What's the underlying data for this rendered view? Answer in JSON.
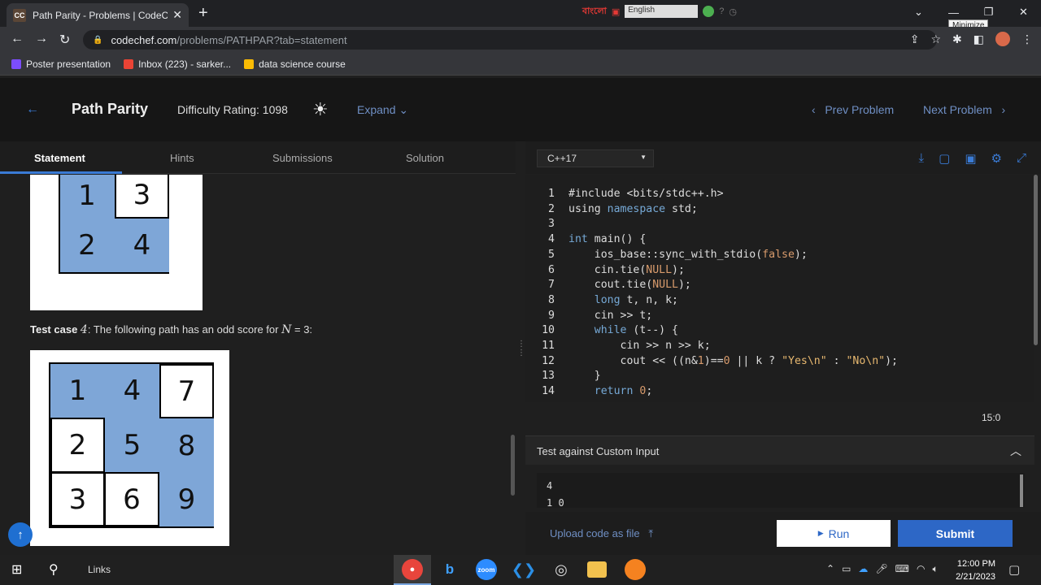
{
  "browser": {
    "tab_title": "Path Parity - Problems | CodeChef",
    "tab_favicon": "CC",
    "url_host": "codechef.com",
    "url_path": "/problems/PATHPAR?tab=statement",
    "tooltip": "Minimize",
    "ext_lang": "বাংলো",
    "ext_select": "English",
    "bookmarks": [
      "Poster presentation",
      "Inbox (223) - sarker...",
      "data science course"
    ]
  },
  "header": {
    "title": "Path Parity",
    "difficulty": "Difficulty Rating: 1098",
    "expand": "Expand",
    "prev": "Prev Problem",
    "next": "Next Problem"
  },
  "left_tabs": [
    "Statement",
    "Hints",
    "Submissions",
    "Solution"
  ],
  "statement": {
    "grid3_top": [
      "1",
      "3",
      "2",
      "4"
    ],
    "tc4_prefix": "Test case",
    "tc4_num": "4",
    "tc4_text": ": The following path has an odd score for",
    "tc4_var": "N",
    "tc4_eq": "= 3:",
    "grid4": [
      "1",
      "4",
      "7",
      "2",
      "5",
      "8",
      "3",
      "6",
      "9"
    ]
  },
  "editor": {
    "language": "C++17",
    "cursor_pos": "15:0",
    "line_numbers": [
      "1",
      "2",
      "3",
      "4",
      "5",
      "6",
      "7",
      "8",
      "9",
      "10",
      "11",
      "12",
      "13",
      "14"
    ]
  },
  "custom_input": {
    "header": "Test against Custom Input",
    "line1": "4",
    "line2": "1 0"
  },
  "actions": {
    "upload": "Upload code as file",
    "run": "Run",
    "submit": "Submit"
  },
  "taskbar": {
    "links": "Links",
    "time": "12:00 PM",
    "date": "2/21/2023"
  },
  "colors": {
    "accent": "#2d67c6",
    "cell_blue": "#7ea6d7"
  }
}
